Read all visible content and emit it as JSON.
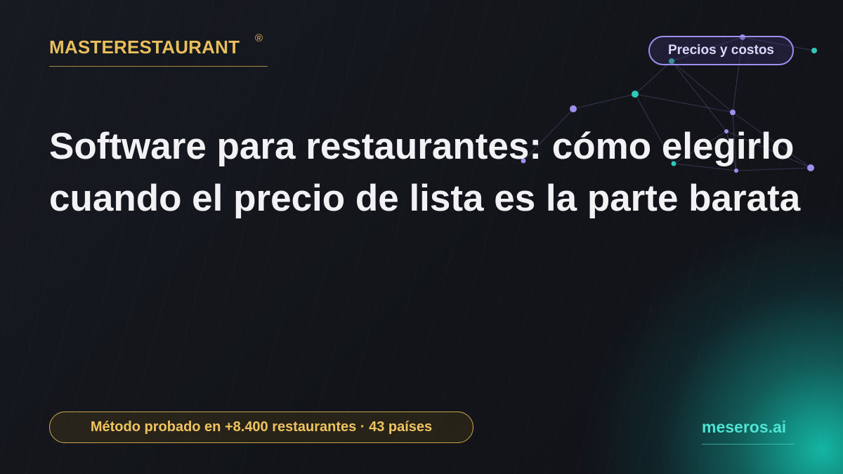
{
  "brand": {
    "name": "MASTERESTAURANT",
    "mark": "®"
  },
  "category": {
    "label": "Precios y costos"
  },
  "title": "Software para restaurantes: cómo elegirlo cuando el precio de lista es la parte barata",
  "badge": {
    "label": "Método probado en +8.400 restaurantes · 43 países"
  },
  "site": {
    "label": "meseros.ai"
  },
  "colors": {
    "background": "#13151b",
    "gold": "#e8bf5a",
    "lavender": "#9d8ff0",
    "teal": "#4fe3d3",
    "title": "#f2f2f4"
  }
}
